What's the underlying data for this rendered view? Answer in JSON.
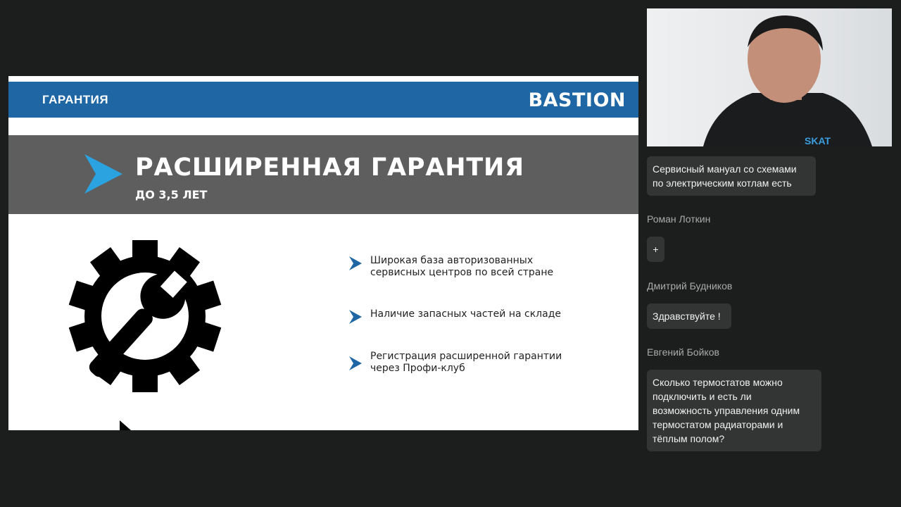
{
  "slide": {
    "section_title": "ГАРАНТИЯ",
    "logo_text": "BASTION",
    "heading": "РАСШИРЕННАЯ ГАРАНТИЯ",
    "subheading": "ДО 3,5 ЛЕТ",
    "bullets": [
      {
        "line1": "Широкая база авторизованных",
        "line2": "сервисных центров по всей стране"
      },
      {
        "line1": "Наличие запасных частей на складе",
        "line2": ""
      },
      {
        "line1": "Регистрация расширенной гарантии",
        "line2": "через Профи-клуб"
      }
    ]
  },
  "webcam": {
    "shirt_logo": "SKAT"
  },
  "chat": [
    {
      "author": "",
      "lines": [
        "Сервисный мануал со схемами",
        "по электрическим котлам есть"
      ]
    },
    {
      "author": "Роман Лоткин",
      "lines": [
        "+"
      ]
    },
    {
      "author": "Дмитрий Будников",
      "lines": [
        "Здравствуйте !"
      ]
    },
    {
      "author": "Евгений Бойков",
      "lines": [
        "Сколько термостатов можно",
        "подключить и есть ли",
        "возможность управления одним",
        "термостатом радиаторами и",
        "тёплым полом?"
      ]
    }
  ],
  "colors": {
    "background": "#1c1e1e",
    "slide_blue": "#1f67a4",
    "slide_band": "#5e5e5e",
    "accent_cyan": "#2aa3e0",
    "chat_bubble": "#333534",
    "chat_author": "#a9abab"
  },
  "icons": [
    "chevron-right-icon",
    "gear-wrench-icon",
    "cursor-icon"
  ]
}
